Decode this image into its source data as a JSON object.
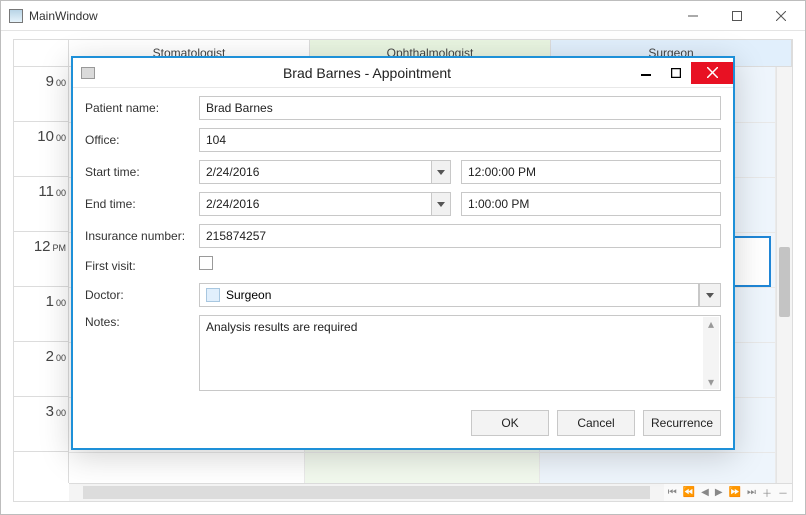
{
  "window": {
    "title": "MainWindow"
  },
  "columns": [
    {
      "label": "Stomatologist"
    },
    {
      "label": "Ophthalmologist"
    },
    {
      "label": "Surgeon"
    }
  ],
  "time_slots": [
    {
      "hour": "9",
      "sup": "00"
    },
    {
      "hour": "10",
      "sup": "00"
    },
    {
      "hour": "11",
      "sup": "00"
    },
    {
      "hour": "12",
      "sup": "PM"
    },
    {
      "hour": "1",
      "sup": "00"
    },
    {
      "hour": "2",
      "sup": "00"
    },
    {
      "hour": "3",
      "sup": "00"
    }
  ],
  "dialog": {
    "title": "Brad Barnes - Appointment",
    "labels": {
      "patient": "Patient name:",
      "office": "Office:",
      "start": "Start time:",
      "end": "End time:",
      "insurance": "Insurance number:",
      "first_visit": "First visit:",
      "doctor": "Doctor:",
      "notes": "Notes:"
    },
    "values": {
      "patient": "Brad Barnes",
      "office": "104",
      "start_date": "2/24/2016",
      "start_time": "12:00:00 PM",
      "end_date": "2/24/2016",
      "end_time": "1:00:00 PM",
      "insurance": "215874257",
      "first_visit_checked": false,
      "doctor": "Surgeon",
      "notes": "Analysis results are required"
    },
    "buttons": {
      "ok": "OK",
      "cancel": "Cancel",
      "recurrence": "Recurrence"
    }
  }
}
